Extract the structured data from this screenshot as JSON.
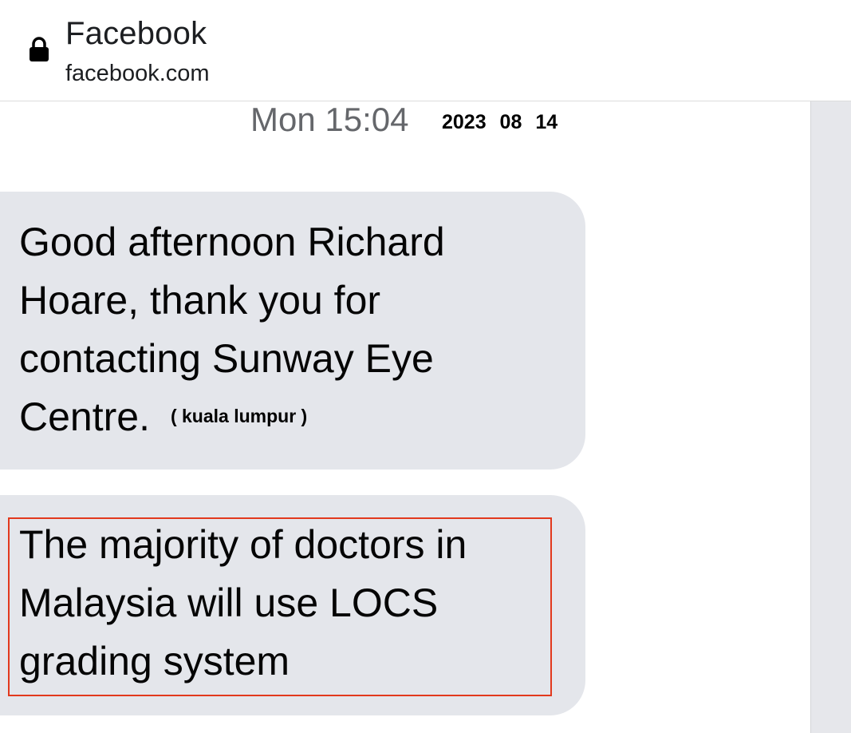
{
  "header": {
    "lock_icon": "lock-icon",
    "title": "Facebook",
    "url": "facebook.com"
  },
  "conversation": {
    "timestamp": "Mon 15:04",
    "date_annotation": "2023 08 14",
    "messages": [
      {
        "text": "Good afternoon Richard Hoare, thank you for contacting Sunway Eye Centre.",
        "annotation": "( kuala lumpur )"
      },
      {
        "text": "The majority of doctors in Malaysia will use LOCS grading system",
        "highlighted": true
      }
    ]
  },
  "colors": {
    "bubble_bg": "#e4e6eb",
    "highlight_border": "#e2391d",
    "timestamp_text": "#65676b"
  }
}
